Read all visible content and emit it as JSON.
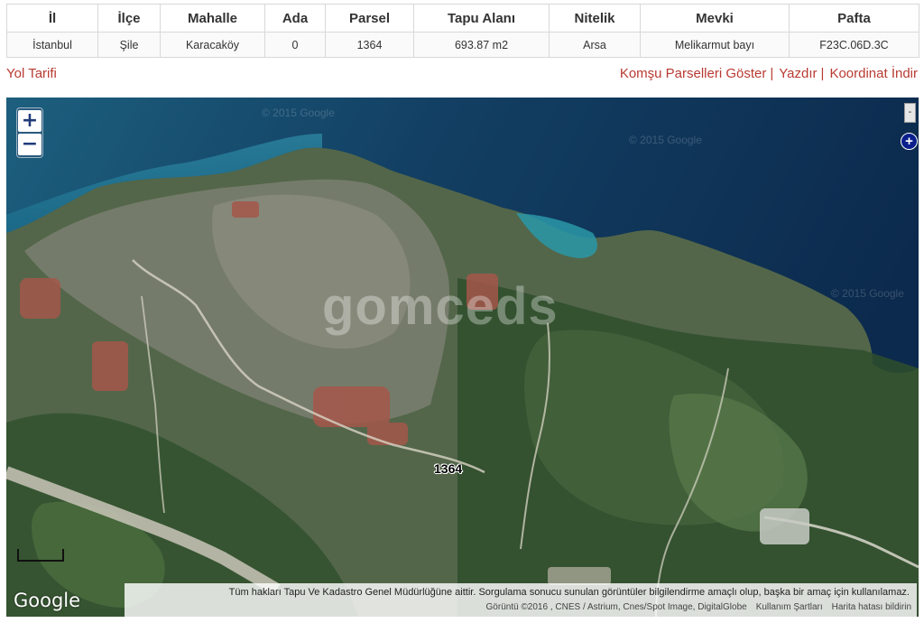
{
  "table": {
    "headers": [
      "İl",
      "İlçe",
      "Mahalle",
      "Ada",
      "Parsel",
      "Tapu Alanı",
      "Nitelik",
      "Mevki",
      "Pafta"
    ],
    "row": [
      "İstanbul",
      "Şile",
      "Karacaköy",
      "0",
      "1364",
      "693.87 m2",
      "Arsa",
      "Melikarmut bayı",
      "F23C.06D.3C"
    ]
  },
  "links": {
    "route": "Yol Tarifi",
    "neighbors": "Komşu Parselleri Göster",
    "print": "Yazdır",
    "coords": "Koordinat İndir",
    "separator": "|"
  },
  "map": {
    "zoom_in": "+",
    "zoom_out": "−",
    "layer_minimize": "-",
    "layer_expand": "+",
    "parcel_label": "1364",
    "watermark": "gomceds",
    "tile_copyright": "© 2015 Google",
    "google_logo": "Google",
    "notice": "Tüm hakları Tapu Ve Kadastro Genel Müdürlüğüne aittir. Sorgulama sonucu sunulan görüntüler bilgilendirme amaçlı olup, başka bir amaç için kullanılamaz.",
    "imagery": "Görüntü ©2016 , CNES / Astrium, Cnes/Spot Image, DigitalGlobe",
    "terms": "Kullanım Şartları",
    "report": "Harita hatası bildirin"
  }
}
